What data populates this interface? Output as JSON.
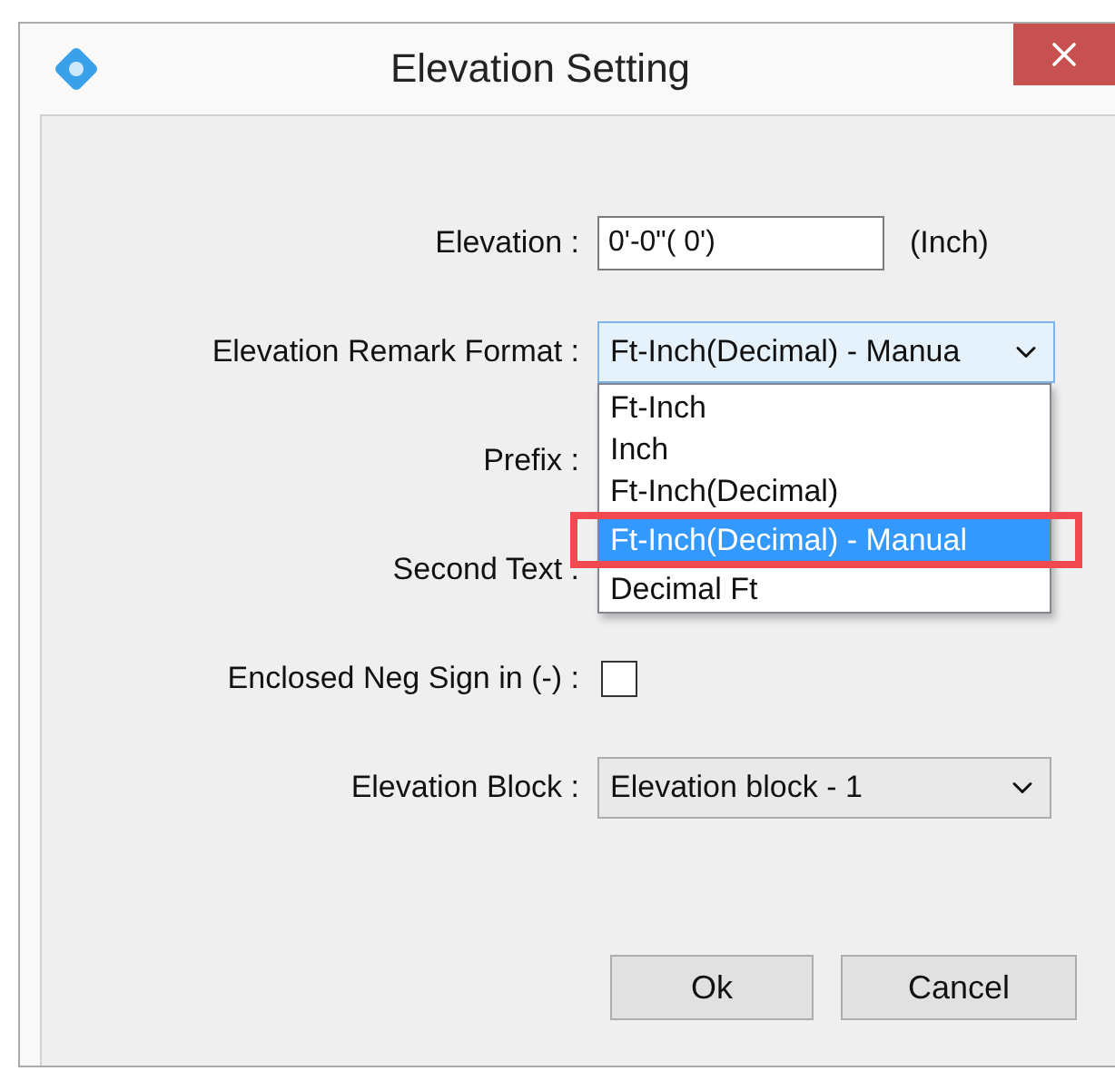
{
  "window": {
    "title": "Elevation Setting"
  },
  "elevation": {
    "label": "Elevation :",
    "value": "0'-0\"( 0')",
    "unit": "(Inch)"
  },
  "remark_format": {
    "label": "Elevation Remark Format :",
    "value": "Ft-Inch(Decimal) - Manua",
    "expanded": true,
    "options": [
      {
        "label": "Ft-Inch",
        "selected": false,
        "highlighted": false
      },
      {
        "label": "Inch",
        "selected": false,
        "highlighted": false
      },
      {
        "label": "Ft-Inch(Decimal)",
        "selected": false,
        "highlighted": false
      },
      {
        "label": "Ft-Inch(Decimal) - Manual",
        "selected": true,
        "highlighted": true
      },
      {
        "label": "Decimal Ft",
        "selected": false,
        "highlighted": false
      }
    ]
  },
  "prefix": {
    "label": "Prefix :"
  },
  "second_text": {
    "label": "Second Text :"
  },
  "enclosed_neg_sign": {
    "label": "Enclosed Neg Sign in (-) :",
    "checked": false
  },
  "elevation_block": {
    "label": "Elevation Block :",
    "value": "Elevation block - 1"
  },
  "buttons": [
    "Ok",
    "Cancel"
  ]
}
